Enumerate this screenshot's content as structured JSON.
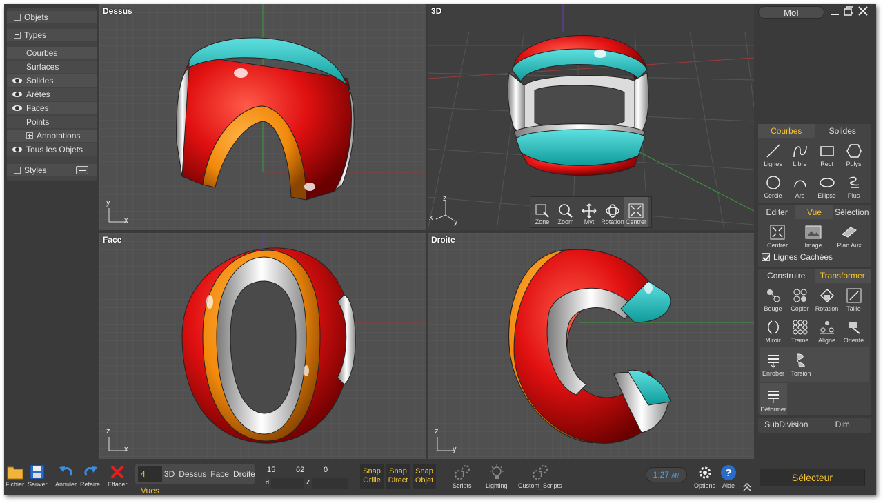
{
  "left_panel": {
    "objects": [
      {
        "label": "Objets",
        "kind": "plus"
      },
      {
        "label": "Types",
        "kind": "minus"
      },
      {
        "label": "Courbes",
        "kind": "none"
      },
      {
        "label": "Surfaces",
        "kind": "none"
      },
      {
        "label": "Solides",
        "kind": "eye"
      },
      {
        "label": "Arêtes",
        "kind": "eye"
      },
      {
        "label": "Faces",
        "kind": "eye"
      },
      {
        "label": "Points",
        "kind": "none"
      },
      {
        "label": "Annotations",
        "kind": "plus"
      },
      {
        "label": "Tous les Objets",
        "kind": "eye"
      },
      {
        "label": "Styles",
        "kind": "plus"
      }
    ]
  },
  "viewports": {
    "top": {
      "title": "Dessus",
      "axis_v": "y",
      "axis_h": "x"
    },
    "persp": {
      "title": "3D",
      "axis_v": "z",
      "axis_h": "y",
      "axis_x": "x"
    },
    "front": {
      "title": "Face",
      "axis_v": "z",
      "axis_h": "x"
    },
    "right": {
      "title": "Droite",
      "axis_v": "z",
      "axis_h": "y"
    }
  },
  "view_tools": [
    {
      "label": "Zone",
      "icon": "zone-icon"
    },
    {
      "label": "Zoom",
      "icon": "zoom-icon"
    },
    {
      "label": "Mvt",
      "icon": "move-icon"
    },
    {
      "label": "Rotation",
      "icon": "rotate-icon"
    },
    {
      "label": "Centrer",
      "icon": "center-icon",
      "active": true
    }
  ],
  "right_panel": {
    "app_title": "MoI",
    "draw_tabs": {
      "tab1": "Courbes",
      "tab2": "Solides"
    },
    "draw_tools": [
      {
        "label": "Lignes",
        "icon": "line-icon"
      },
      {
        "label": "Libre",
        "icon": "freehand-icon"
      },
      {
        "label": "Rect",
        "icon": "rect-icon"
      },
      {
        "label": "Polys",
        "icon": "polygon-icon"
      },
      {
        "label": "Cercle",
        "icon": "circle-icon"
      },
      {
        "label": "Arc",
        "icon": "arc-icon"
      },
      {
        "label": "Ellipse",
        "icon": "ellipse-icon"
      },
      {
        "label": "Plus",
        "icon": "more-icon"
      }
    ],
    "view_tabs": {
      "tab1": "Editer",
      "tab2": "Vue",
      "tab3": "Sélection"
    },
    "view_tools": [
      {
        "label": "Centrer",
        "icon": "center-icon"
      },
      {
        "label": "Image",
        "icon": "image-icon"
      },
      {
        "label": "Plan Aux",
        "icon": "plane-icon"
      }
    ],
    "hidden_lines": "Lignes Cachées",
    "transform_tabs": {
      "tab1": "Construire",
      "tab2": "Transformer"
    },
    "transform_tools": [
      {
        "label": "Bouge",
        "icon": "move-icon"
      },
      {
        "label": "Copier",
        "icon": "copy-icon"
      },
      {
        "label": "Rotation",
        "icon": "rotate-icon"
      },
      {
        "label": "Taille",
        "icon": "scale-icon"
      },
      {
        "label": "Miroir",
        "icon": "mirror-icon"
      },
      {
        "label": "Trame",
        "icon": "array-icon"
      },
      {
        "label": "Aligne",
        "icon": "align-icon"
      },
      {
        "label": "Oriente",
        "icon": "orient-icon"
      }
    ],
    "deform_tools": [
      {
        "label": "Enrober",
        "icon": "wrap-icon"
      },
      {
        "label": "Torsion",
        "icon": "twist-icon"
      }
    ],
    "deform_label": "Déformer",
    "bottom_tabs": {
      "tab1": "SubDivision",
      "tab2": "Dim"
    }
  },
  "bottom_bar": {
    "file": "Fichier",
    "save": "Sauver",
    "undo": "Annuler",
    "redo": "Refaire",
    "delete": "Effacer",
    "views": [
      "4 Vues",
      "3D",
      "Dessus",
      "Face",
      "Droite"
    ],
    "coords": {
      "x": "15",
      "y": "62",
      "z": "0",
      "d_label": "d",
      "angle_label": "∠"
    },
    "snaps": [
      {
        "line1": "Snap",
        "line2": "Grille"
      },
      {
        "line1": "Snap",
        "line2": "Direct"
      },
      {
        "line1": "Snap",
        "line2": "Objet"
      }
    ],
    "scripts": "Scripts",
    "lighting": "Lighting",
    "custom_scripts": "Custom_Scripts",
    "clock_time": "1:27",
    "clock_ampm": "AM",
    "options": "Options",
    "help": "Aide",
    "selector": "Sélecteur"
  },
  "colors": {
    "accent": "#f7c531",
    "red": "#e01010",
    "orange": "#f28a0c",
    "teal": "#1ab7b7",
    "blue": "#4ea8e6"
  }
}
